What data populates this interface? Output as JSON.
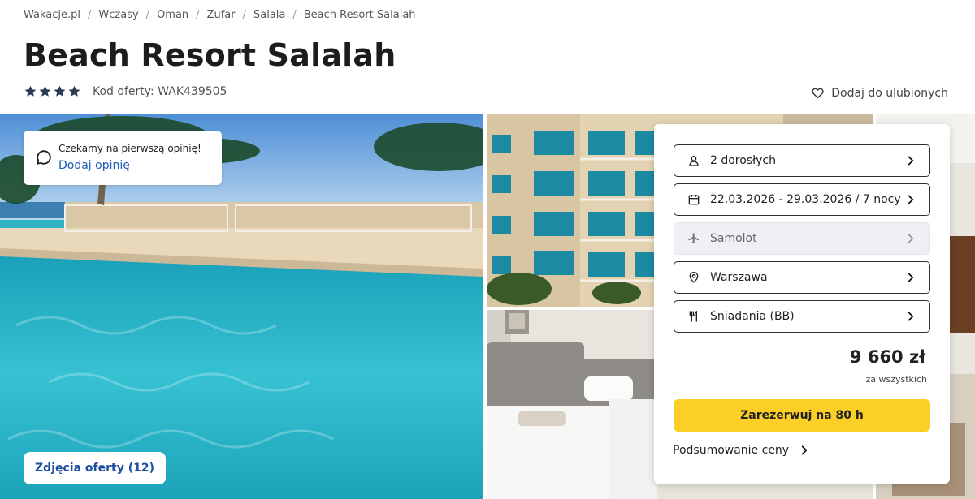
{
  "breadcrumb": [
    {
      "label": "Wakacje.pl"
    },
    {
      "label": "Wczasy"
    },
    {
      "label": "Oman"
    },
    {
      "label": "Zufar"
    },
    {
      "label": "Salala"
    },
    {
      "label": "Beach Resort Salalah"
    }
  ],
  "breadcrumb_separator": "/",
  "hotel": {
    "name": "Beach Resort Salalah",
    "stars": 4,
    "offer_code": "Kod oferty: WAK439505"
  },
  "favorite": {
    "label": "Dodaj do ulubionych",
    "icon": "heart-icon"
  },
  "review": {
    "message": "Czekamy na pierwszą opinię!",
    "link": "Dodaj opinię",
    "icon": "speech-bubble-icon"
  },
  "gallery": {
    "button_label": "Zdjęcia oferty (12)"
  },
  "booking": {
    "fields": [
      {
        "label": "2 dorosłych",
        "icon": "person-icon",
        "disabled": false
      },
      {
        "label": "22.03.2026 - 29.03.2026 / 7 nocy",
        "icon": "calendar-icon",
        "disabled": false
      },
      {
        "label": "Samolot",
        "icon": "plane-icon",
        "disabled": true
      },
      {
        "label": "Warszawa",
        "icon": "location-pin-icon",
        "disabled": false
      },
      {
        "label": "Śniadania (BB)",
        "icon": "fork-knife-icon",
        "disabled": false
      }
    ],
    "price": "9 660 zł",
    "price_note": "za wszystkich",
    "book_button": "Zarezerwuj na 80 h",
    "summary_link": "Podsumowanie ceny"
  },
  "colors": {
    "accent_yellow": "#fbcf26",
    "link_blue": "#1d5bb5",
    "star_navy": "#2c3a55"
  }
}
